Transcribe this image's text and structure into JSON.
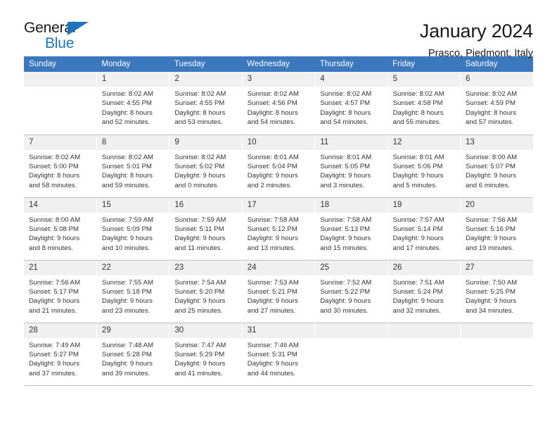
{
  "brand": {
    "name_top": "General",
    "name_bottom": "Blue",
    "accent_color": "#1b75bb"
  },
  "header": {
    "title": "January 2024",
    "subtitle": "Prasco, Piedmont, Italy"
  },
  "theme": {
    "header_row_bg": "#3b78bd",
    "daynum_bg": "#f0f0f0",
    "text_color": "#333333"
  },
  "columns": [
    "Sunday",
    "Monday",
    "Tuesday",
    "Wednesday",
    "Thursday",
    "Friday",
    "Saturday"
  ],
  "weeks": [
    [
      {
        "day": "",
        "sunrise": "",
        "sunset": "",
        "daylight1": "",
        "daylight2": "",
        "blank": true
      },
      {
        "day": "1",
        "sunrise": "Sunrise: 8:02 AM",
        "sunset": "Sunset: 4:55 PM",
        "daylight1": "Daylight: 8 hours",
        "daylight2": "and 52 minutes."
      },
      {
        "day": "2",
        "sunrise": "Sunrise: 8:02 AM",
        "sunset": "Sunset: 4:55 PM",
        "daylight1": "Daylight: 8 hours",
        "daylight2": "and 53 minutes."
      },
      {
        "day": "3",
        "sunrise": "Sunrise: 8:02 AM",
        "sunset": "Sunset: 4:56 PM",
        "daylight1": "Daylight: 8 hours",
        "daylight2": "and 54 minutes."
      },
      {
        "day": "4",
        "sunrise": "Sunrise: 8:02 AM",
        "sunset": "Sunset: 4:57 PM",
        "daylight1": "Daylight: 8 hours",
        "daylight2": "and 54 minutes."
      },
      {
        "day": "5",
        "sunrise": "Sunrise: 8:02 AM",
        "sunset": "Sunset: 4:58 PM",
        "daylight1": "Daylight: 8 hours",
        "daylight2": "and 55 minutes."
      },
      {
        "day": "6",
        "sunrise": "Sunrise: 8:02 AM",
        "sunset": "Sunset: 4:59 PM",
        "daylight1": "Daylight: 8 hours",
        "daylight2": "and 57 minutes."
      }
    ],
    [
      {
        "day": "7",
        "sunrise": "Sunrise: 8:02 AM",
        "sunset": "Sunset: 5:00 PM",
        "daylight1": "Daylight: 8 hours",
        "daylight2": "and 58 minutes."
      },
      {
        "day": "8",
        "sunrise": "Sunrise: 8:02 AM",
        "sunset": "Sunset: 5:01 PM",
        "daylight1": "Daylight: 8 hours",
        "daylight2": "and 59 minutes."
      },
      {
        "day": "9",
        "sunrise": "Sunrise: 8:02 AM",
        "sunset": "Sunset: 5:02 PM",
        "daylight1": "Daylight: 9 hours",
        "daylight2": "and 0 minutes."
      },
      {
        "day": "10",
        "sunrise": "Sunrise: 8:01 AM",
        "sunset": "Sunset: 5:04 PM",
        "daylight1": "Daylight: 9 hours",
        "daylight2": "and 2 minutes."
      },
      {
        "day": "11",
        "sunrise": "Sunrise: 8:01 AM",
        "sunset": "Sunset: 5:05 PM",
        "daylight1": "Daylight: 9 hours",
        "daylight2": "and 3 minutes."
      },
      {
        "day": "12",
        "sunrise": "Sunrise: 8:01 AM",
        "sunset": "Sunset: 5:06 PM",
        "daylight1": "Daylight: 9 hours",
        "daylight2": "and 5 minutes."
      },
      {
        "day": "13",
        "sunrise": "Sunrise: 8:00 AM",
        "sunset": "Sunset: 5:07 PM",
        "daylight1": "Daylight: 9 hours",
        "daylight2": "and 6 minutes."
      }
    ],
    [
      {
        "day": "14",
        "sunrise": "Sunrise: 8:00 AM",
        "sunset": "Sunset: 5:08 PM",
        "daylight1": "Daylight: 9 hours",
        "daylight2": "and 8 minutes."
      },
      {
        "day": "15",
        "sunrise": "Sunrise: 7:59 AM",
        "sunset": "Sunset: 5:09 PM",
        "daylight1": "Daylight: 9 hours",
        "daylight2": "and 10 minutes."
      },
      {
        "day": "16",
        "sunrise": "Sunrise: 7:59 AM",
        "sunset": "Sunset: 5:11 PM",
        "daylight1": "Daylight: 9 hours",
        "daylight2": "and 11 minutes."
      },
      {
        "day": "17",
        "sunrise": "Sunrise: 7:58 AM",
        "sunset": "Sunset: 5:12 PM",
        "daylight1": "Daylight: 9 hours",
        "daylight2": "and 13 minutes."
      },
      {
        "day": "18",
        "sunrise": "Sunrise: 7:58 AM",
        "sunset": "Sunset: 5:13 PM",
        "daylight1": "Daylight: 9 hours",
        "daylight2": "and 15 minutes."
      },
      {
        "day": "19",
        "sunrise": "Sunrise: 7:57 AM",
        "sunset": "Sunset: 5:14 PM",
        "daylight1": "Daylight: 9 hours",
        "daylight2": "and 17 minutes."
      },
      {
        "day": "20",
        "sunrise": "Sunrise: 7:56 AM",
        "sunset": "Sunset: 5:16 PM",
        "daylight1": "Daylight: 9 hours",
        "daylight2": "and 19 minutes."
      }
    ],
    [
      {
        "day": "21",
        "sunrise": "Sunrise: 7:56 AM",
        "sunset": "Sunset: 5:17 PM",
        "daylight1": "Daylight: 9 hours",
        "daylight2": "and 21 minutes."
      },
      {
        "day": "22",
        "sunrise": "Sunrise: 7:55 AM",
        "sunset": "Sunset: 5:18 PM",
        "daylight1": "Daylight: 9 hours",
        "daylight2": "and 23 minutes."
      },
      {
        "day": "23",
        "sunrise": "Sunrise: 7:54 AM",
        "sunset": "Sunset: 5:20 PM",
        "daylight1": "Daylight: 9 hours",
        "daylight2": "and 25 minutes."
      },
      {
        "day": "24",
        "sunrise": "Sunrise: 7:53 AM",
        "sunset": "Sunset: 5:21 PM",
        "daylight1": "Daylight: 9 hours",
        "daylight2": "and 27 minutes."
      },
      {
        "day": "25",
        "sunrise": "Sunrise: 7:52 AM",
        "sunset": "Sunset: 5:22 PM",
        "daylight1": "Daylight: 9 hours",
        "daylight2": "and 30 minutes."
      },
      {
        "day": "26",
        "sunrise": "Sunrise: 7:51 AM",
        "sunset": "Sunset: 5:24 PM",
        "daylight1": "Daylight: 9 hours",
        "daylight2": "and 32 minutes."
      },
      {
        "day": "27",
        "sunrise": "Sunrise: 7:50 AM",
        "sunset": "Sunset: 5:25 PM",
        "daylight1": "Daylight: 9 hours",
        "daylight2": "and 34 minutes."
      }
    ],
    [
      {
        "day": "28",
        "sunrise": "Sunrise: 7:49 AM",
        "sunset": "Sunset: 5:27 PM",
        "daylight1": "Daylight: 9 hours",
        "daylight2": "and 37 minutes."
      },
      {
        "day": "29",
        "sunrise": "Sunrise: 7:48 AM",
        "sunset": "Sunset: 5:28 PM",
        "daylight1": "Daylight: 9 hours",
        "daylight2": "and 39 minutes."
      },
      {
        "day": "30",
        "sunrise": "Sunrise: 7:47 AM",
        "sunset": "Sunset: 5:29 PM",
        "daylight1": "Daylight: 9 hours",
        "daylight2": "and 41 minutes."
      },
      {
        "day": "31",
        "sunrise": "Sunrise: 7:46 AM",
        "sunset": "Sunset: 5:31 PM",
        "daylight1": "Daylight: 9 hours",
        "daylight2": "and 44 minutes."
      },
      {
        "day": "",
        "sunrise": "",
        "sunset": "",
        "daylight1": "",
        "daylight2": "",
        "empty": true
      },
      {
        "day": "",
        "sunrise": "",
        "sunset": "",
        "daylight1": "",
        "daylight2": "",
        "empty": true
      },
      {
        "day": "",
        "sunrise": "",
        "sunset": "",
        "daylight1": "",
        "daylight2": "",
        "empty": true
      }
    ]
  ]
}
